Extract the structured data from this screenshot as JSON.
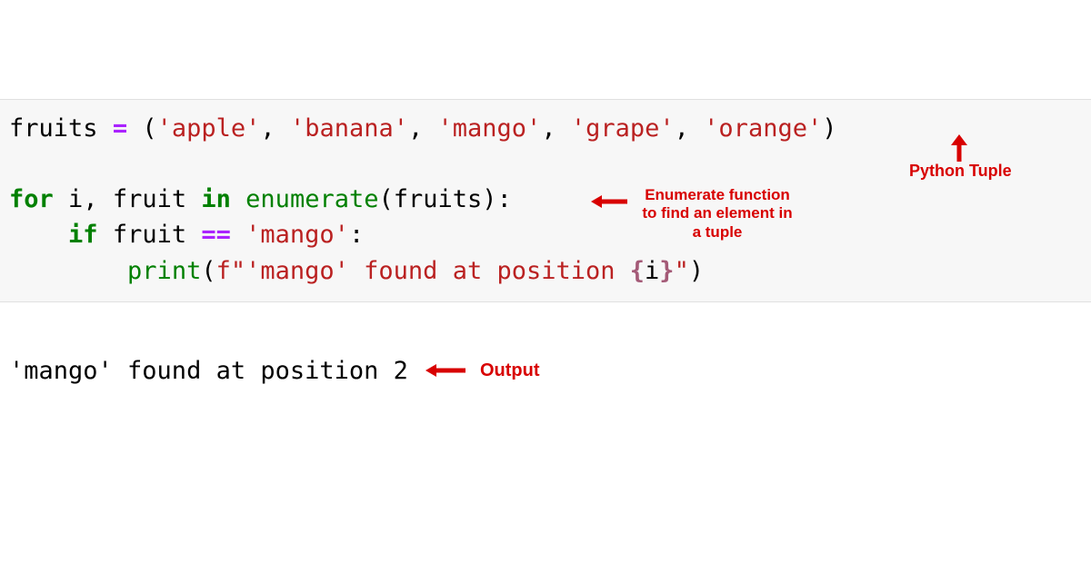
{
  "code": {
    "line1": {
      "var": "fruits",
      "op": "=",
      "lp": "(",
      "s1": "'apple'",
      "c1": ",",
      "s2": "'banana'",
      "c2": ",",
      "s3": "'mango'",
      "c3": ",",
      "s4": "'grape'",
      "c4": ",",
      "s5": "'orange'",
      "rp": ")"
    },
    "blank": "",
    "line3": {
      "kfor": "for",
      "i": "i",
      "comma": ",",
      "fruit": "fruit",
      "kin": "in",
      "enum": "enumerate",
      "lp": "(",
      "arg": "fruits",
      "rp": ")",
      "colon": ":"
    },
    "line4": {
      "indent": "    ",
      "kif": "if",
      "fruit": "fruit",
      "eq": "==",
      "str": "'mango'",
      "colon": ":"
    },
    "line5": {
      "indent": "        ",
      "print": "print",
      "lp": "(",
      "fpfx": "f",
      "sopen": "\"'mango' found at position ",
      "interp_open": "{",
      "interp_var": "i",
      "interp_close": "}",
      "sclose": "\"",
      "rp": ")"
    }
  },
  "output_text": "'mango' found at position 2",
  "annotations": {
    "tuple": "Python Tuple",
    "enum_l1": "Enumerate function",
    "enum_l2": "to find an element in",
    "enum_l3": "a tuple",
    "out": "Output"
  },
  "colors": {
    "annotation": "#d80000"
  }
}
